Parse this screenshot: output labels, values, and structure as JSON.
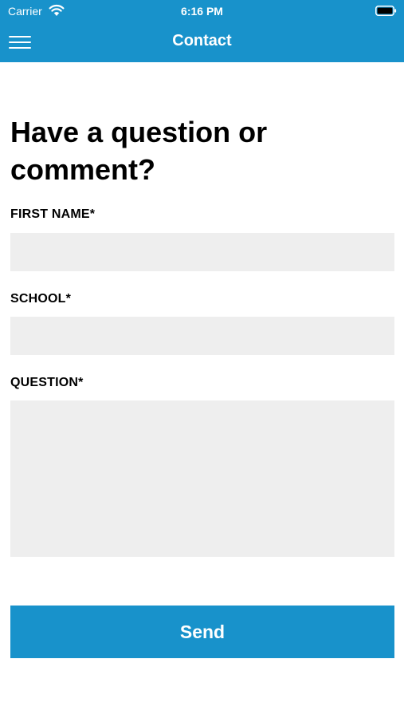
{
  "status_bar": {
    "carrier": "Carrier",
    "time": "6:16 PM",
    "wifi_icon": "wifi-icon",
    "battery_icon": "battery-icon"
  },
  "nav": {
    "title": "Contact",
    "menu_icon": "hamburger-menu-icon"
  },
  "headline": "Have a question or comment?",
  "form": {
    "first_name": {
      "label": "FIRST NAME*",
      "value": "",
      "placeholder": ""
    },
    "school": {
      "label": "SCHOOL*",
      "value": "",
      "placeholder": ""
    },
    "question": {
      "label": "QUESTION*",
      "value": "",
      "placeholder": ""
    },
    "send_label": "Send"
  },
  "colors": {
    "accent": "#1892cb",
    "field_background": "#eeeeee",
    "text": "#000000",
    "on_accent": "#ffffff"
  }
}
